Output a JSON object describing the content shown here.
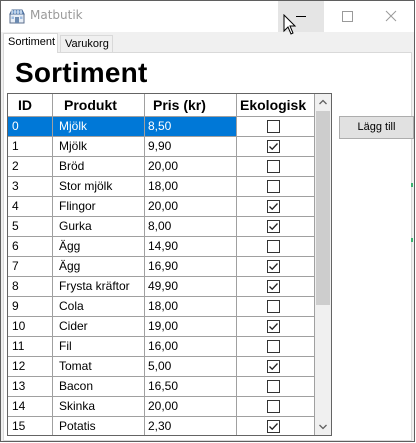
{
  "window": {
    "title": "Matbutik",
    "icon": "store-icon",
    "controls": [
      "minimize-icon",
      "maximize-icon",
      "close-icon"
    ]
  },
  "tabs": [
    {
      "label": "Sortiment",
      "active": true
    },
    {
      "label": "Varukorg",
      "active": false
    }
  ],
  "page": {
    "title": "Sortiment",
    "add_button_label": "Lägg till"
  },
  "grid": {
    "columns": [
      "ID",
      "Produkt",
      "Pris (kr)",
      "Ekologisk"
    ],
    "selected_row": 0,
    "rows": [
      {
        "id": "0",
        "produkt": "Mjölk",
        "pris": "8,50",
        "ekologisk": false
      },
      {
        "id": "1",
        "produkt": "Mjölk",
        "pris": "9,90",
        "ekologisk": true
      },
      {
        "id": "2",
        "produkt": "Bröd",
        "pris": "20,00",
        "ekologisk": false
      },
      {
        "id": "3",
        "produkt": "Stor mjölk",
        "pris": "18,00",
        "ekologisk": false
      },
      {
        "id": "4",
        "produkt": "Flingor",
        "pris": "20,00",
        "ekologisk": true
      },
      {
        "id": "5",
        "produkt": "Gurka",
        "pris": "8,00",
        "ekologisk": true
      },
      {
        "id": "6",
        "produkt": "Ägg",
        "pris": "14,90",
        "ekologisk": false
      },
      {
        "id": "7",
        "produkt": "Ägg",
        "pris": "16,90",
        "ekologisk": true
      },
      {
        "id": "8",
        "produkt": "Frysta kräftor",
        "pris": "49,90",
        "ekologisk": true
      },
      {
        "id": "9",
        "produkt": "Cola",
        "pris": "18,00",
        "ekologisk": false
      },
      {
        "id": "10",
        "produkt": "Cider",
        "pris": "19,00",
        "ekologisk": true
      },
      {
        "id": "11",
        "produkt": "Fil",
        "pris": "16,00",
        "ekologisk": false
      },
      {
        "id": "12",
        "produkt": "Tomat",
        "pris": "5,00",
        "ekologisk": true
      },
      {
        "id": "13",
        "produkt": "Bacon",
        "pris": "16,50",
        "ekologisk": false
      },
      {
        "id": "14",
        "produkt": "Skinka",
        "pris": "20,00",
        "ekologisk": false
      },
      {
        "id": "15",
        "produkt": "Potatis",
        "pris": "2,30",
        "ekologisk": true
      }
    ]
  },
  "colors": {
    "selection": "#0078d7",
    "header_text": "#000000",
    "grid_line": "#a0a0a0"
  }
}
